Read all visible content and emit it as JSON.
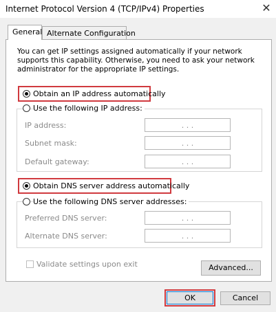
{
  "window": {
    "title": "Internet Protocol Version 4 (TCP/IPv4) Properties",
    "close_glyph": "✕"
  },
  "tabs": [
    {
      "label": "General",
      "active": true
    },
    {
      "label": "Alternate Configuration",
      "active": false
    }
  ],
  "general": {
    "description": "You can get IP settings assigned automatically if your network supports this capability. Otherwise, you need to ask your network administrator for the appropriate IP settings.",
    "ip_mode": {
      "auto_label": "Obtain an IP address automatically",
      "manual_label": "Use the following IP address:",
      "selected": "auto"
    },
    "ip_fields": [
      {
        "label": "IP address:",
        "value": ".    .    ."
      },
      {
        "label": "Subnet mask:",
        "value": ".    .    ."
      },
      {
        "label": "Default gateway:",
        "value": ".    .    ."
      }
    ],
    "dns_mode": {
      "auto_label": "Obtain DNS server address automatically",
      "manual_label": "Use the following DNS server addresses:",
      "selected": "auto"
    },
    "dns_fields": [
      {
        "label": "Preferred DNS server:",
        "value": ".    .    ."
      },
      {
        "label": "Alternate DNS server:",
        "value": ".    .    ."
      }
    ],
    "validate_label": "Validate settings upon exit",
    "advanced_label": "Advanced..."
  },
  "buttons": {
    "ok": "OK",
    "cancel": "Cancel"
  },
  "colors": {
    "highlight": "#d0393e",
    "dialog_bg": "#f0f0f0",
    "disabled_text": "#8a8a8a"
  }
}
